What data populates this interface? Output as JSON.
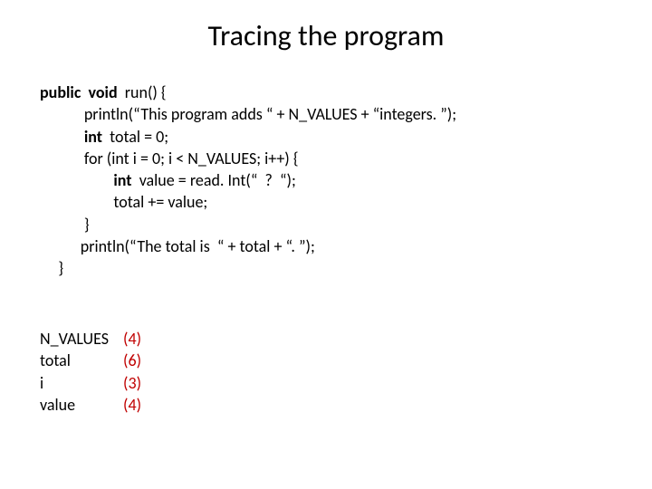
{
  "title": "Tracing the program",
  "code": {
    "l1a": "public",
    "l1b": "void",
    "l1c": "run() {",
    "l2": "println(“This program adds “ + N_VALUES + “integers. ”);",
    "l3a": "int",
    "l3b": "total = 0;",
    "l4a": "for (int i = 0; i < N_VALUES; i++) {",
    "l5a": "int",
    "l5b": "value = read. Int(“  ?  “);",
    "l6": "total += value;",
    "l7": "}",
    "l8": "println(“The total is  “ + total + “. ”);",
    "l9": "}"
  },
  "trace": {
    "rows": [
      {
        "label": "N_VALUES",
        "value": "(4)"
      },
      {
        "label": "total",
        "value": "(6)"
      },
      {
        "label": "i",
        "value": "(3)"
      },
      {
        "label": "value",
        "value": "(4)"
      }
    ]
  }
}
